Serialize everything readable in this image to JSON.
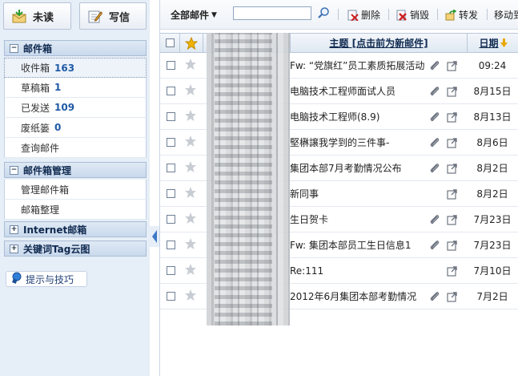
{
  "toolbar_left": {
    "unread_label": "未读",
    "write_label": "写信"
  },
  "sidebar": {
    "mailbox_section": "邮件箱",
    "items": [
      {
        "label": "收件箱",
        "count": "163"
      },
      {
        "label": "草稿箱",
        "count": "1"
      },
      {
        "label": "已发送",
        "count": "109"
      },
      {
        "label": "废纸篓",
        "count": "0"
      },
      {
        "label": "查询邮件",
        "count": ""
      }
    ],
    "mgmt_section": "邮件箱管理",
    "mgmt_items": [
      {
        "label": "管理邮件箱"
      },
      {
        "label": "邮箱整理"
      }
    ],
    "internet_section": "Internet邮箱",
    "tag_section": "关键词Tag云图",
    "tips_label": "提示与技巧"
  },
  "toolbar": {
    "all_mail": "全部邮件",
    "search_value": "",
    "delete": "删除",
    "destroy": "销毁",
    "forward": "转发",
    "move": "移动到"
  },
  "grid": {
    "subject_header": "主题 [点击前为新邮件]",
    "date_header": "日期",
    "rows": [
      {
        "subject": "Fw: “党旗红”员工素质拓展活动",
        "attach": true,
        "date": "09:24"
      },
      {
        "subject": "电脑技术工程师面试人员",
        "attach": true,
        "date": "8月15日"
      },
      {
        "subject": "电脑技术工程师(8.9)",
        "attach": true,
        "date": "8月13日"
      },
      {
        "subject": "堅楙譲我学到的三件事-",
        "attach": true,
        "date": "8月6日"
      },
      {
        "subject": "集团本部7月考勤情况公布",
        "attach": true,
        "date": "8月2日"
      },
      {
        "subject": "新同事",
        "attach": false,
        "date": "8月2日"
      },
      {
        "subject": "生日贺卡",
        "attach": true,
        "date": "7月23日"
      },
      {
        "subject": "Fw: 集团本部员工生日信息1",
        "attach": true,
        "date": "7月23日"
      },
      {
        "subject": "Re:111",
        "attach": false,
        "date": "7月10日"
      },
      {
        "subject": "2012年6月集团本部考勤情况",
        "attach": true,
        "date": "7月2日"
      }
    ]
  },
  "colors": {
    "accent": "#1f5aa6",
    "sidebar_bg": "#e6eef7",
    "section_bg": "#c9d9ec",
    "star": "#f0b400",
    "delete_red": "#cc2222"
  }
}
